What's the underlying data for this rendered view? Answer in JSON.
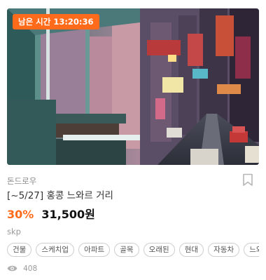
{
  "product": {
    "timer_label": "남은 시간 13:20:36",
    "shop_name": "돈드로우",
    "title": "[~5/27] 홍콩 느와르 거리",
    "discount": "30%",
    "price": "31,500원",
    "format": "skp",
    "tags": [
      "건물",
      "스케치업",
      "아파트",
      "골목",
      "오래된",
      "현대",
      "자동차",
      "느와르"
    ],
    "views": "408"
  },
  "icons": {
    "bookmark": "bookmark-icon",
    "views": "eye-icon"
  },
  "colors": {
    "accent": "#ff6b1a",
    "muted": "#9a9a9a"
  }
}
